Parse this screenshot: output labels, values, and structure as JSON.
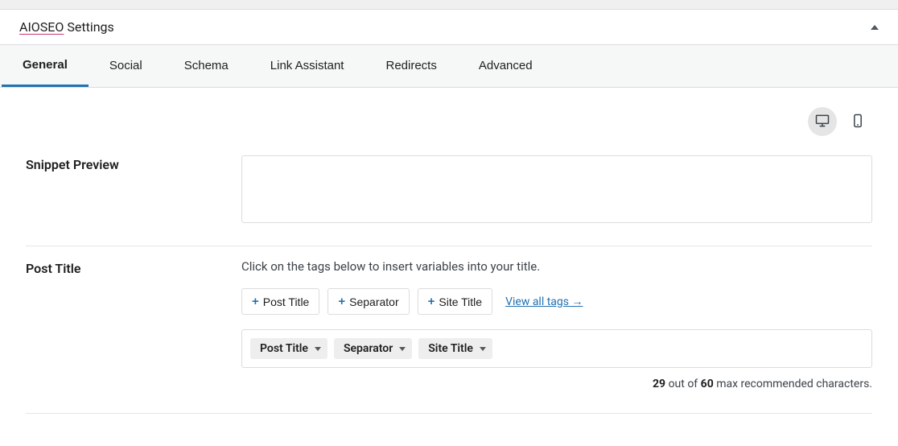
{
  "panel": {
    "brand": "AIOSEO",
    "title_suffix": " Settings"
  },
  "tabs": [
    {
      "label": "General",
      "active": true
    },
    {
      "label": "Social",
      "active": false
    },
    {
      "label": "Schema",
      "active": false
    },
    {
      "label": "Link Assistant",
      "active": false
    },
    {
      "label": "Redirects",
      "active": false
    },
    {
      "label": "Advanced",
      "active": false
    }
  ],
  "snippet_preview": {
    "label": "Snippet Preview"
  },
  "post_title": {
    "label": "Post Title",
    "hint": "Click on the tags below to insert variables into your title.",
    "tag_buttons": [
      {
        "label": "Post Title"
      },
      {
        "label": "Separator"
      },
      {
        "label": "Site Title"
      }
    ],
    "view_all": "View all tags →",
    "chips": [
      {
        "label": "Post Title"
      },
      {
        "label": "Separator"
      },
      {
        "label": "Site Title"
      }
    ],
    "char_count": {
      "current": "29",
      "mid": " out of ",
      "max": "60",
      "suffix": " max recommended characters."
    }
  }
}
